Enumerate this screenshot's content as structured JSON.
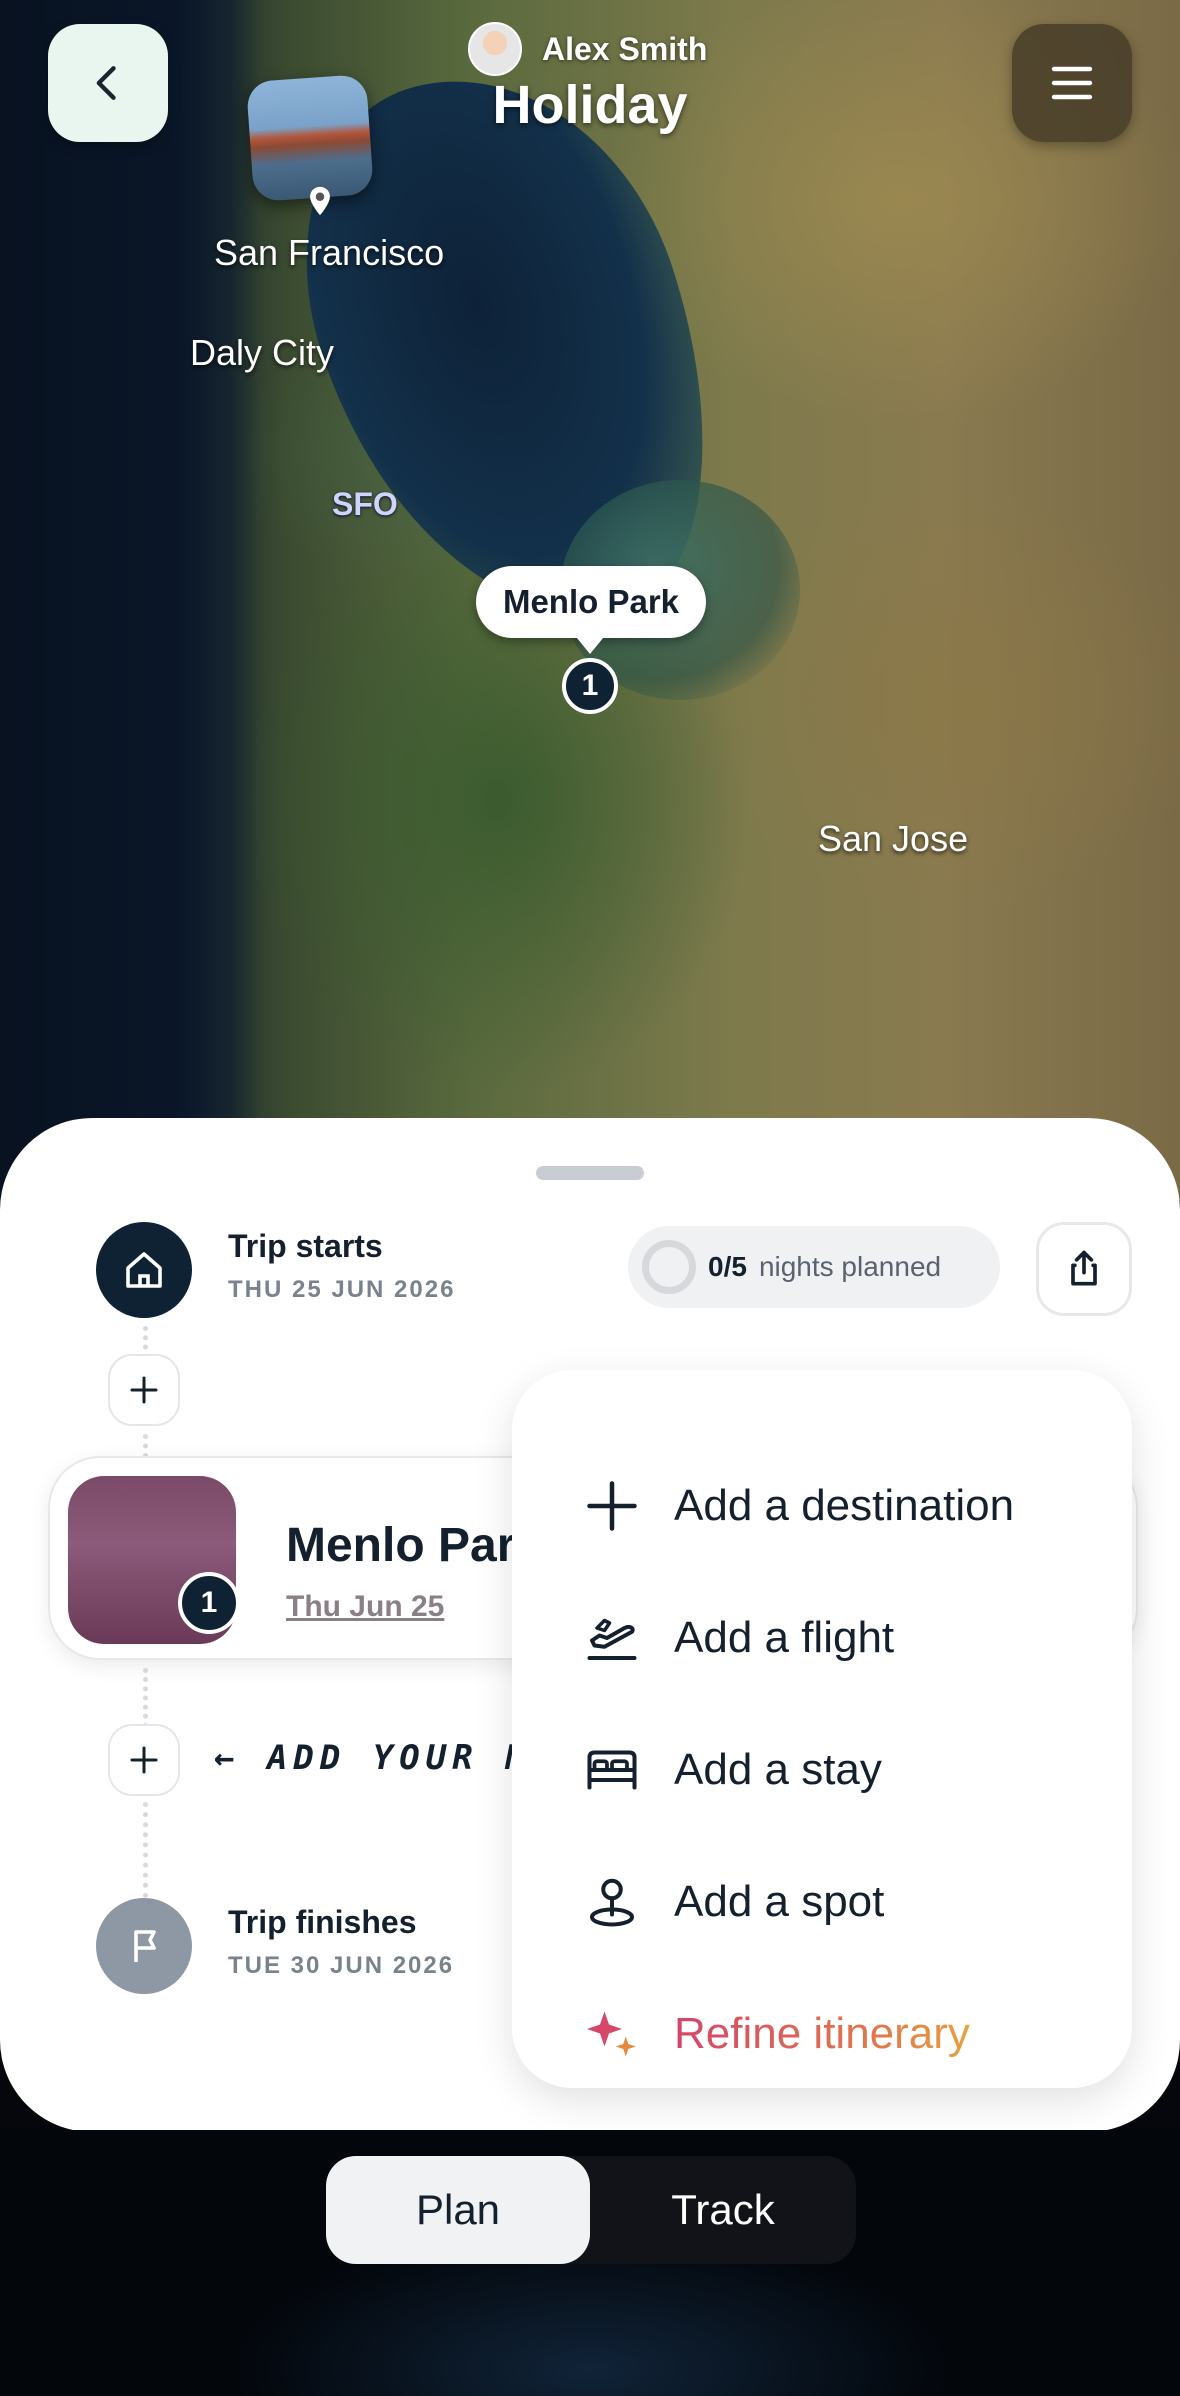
{
  "header": {
    "user_name": "Alex Smith",
    "trip_title": "Holiday"
  },
  "map": {
    "labels": {
      "san_francisco": "San Francisco",
      "daly_city": "Daly City",
      "sfo": "SFO",
      "san_jose": "San Jose"
    },
    "callout": "Menlo Park",
    "marker_number": "1"
  },
  "sheet": {
    "nights": {
      "count": "0/5",
      "text": "nights planned"
    },
    "trip_start": {
      "title": "Trip starts",
      "date": "THU 25 JUN 2026"
    },
    "destination": {
      "name": "Menlo Park",
      "date": "Thu Jun 25",
      "badge": "1"
    },
    "hint": "← ADD YOUR NEXT DESTINATION",
    "trip_finish": {
      "title": "Trip finishes",
      "date": "TUE 30 JUN 2026"
    }
  },
  "add_menu": {
    "items": [
      {
        "label": "Add a destination",
        "icon": "plus-icon"
      },
      {
        "label": "Add a flight",
        "icon": "plane-icon"
      },
      {
        "label": "Add a stay",
        "icon": "bed-icon"
      },
      {
        "label": "Add a spot",
        "icon": "pin-icon"
      },
      {
        "label": "Refine itinerary",
        "icon": "sparkle-icon"
      }
    ]
  },
  "tabs": {
    "plan": "Plan",
    "track": "Track",
    "active": "Plan"
  }
}
